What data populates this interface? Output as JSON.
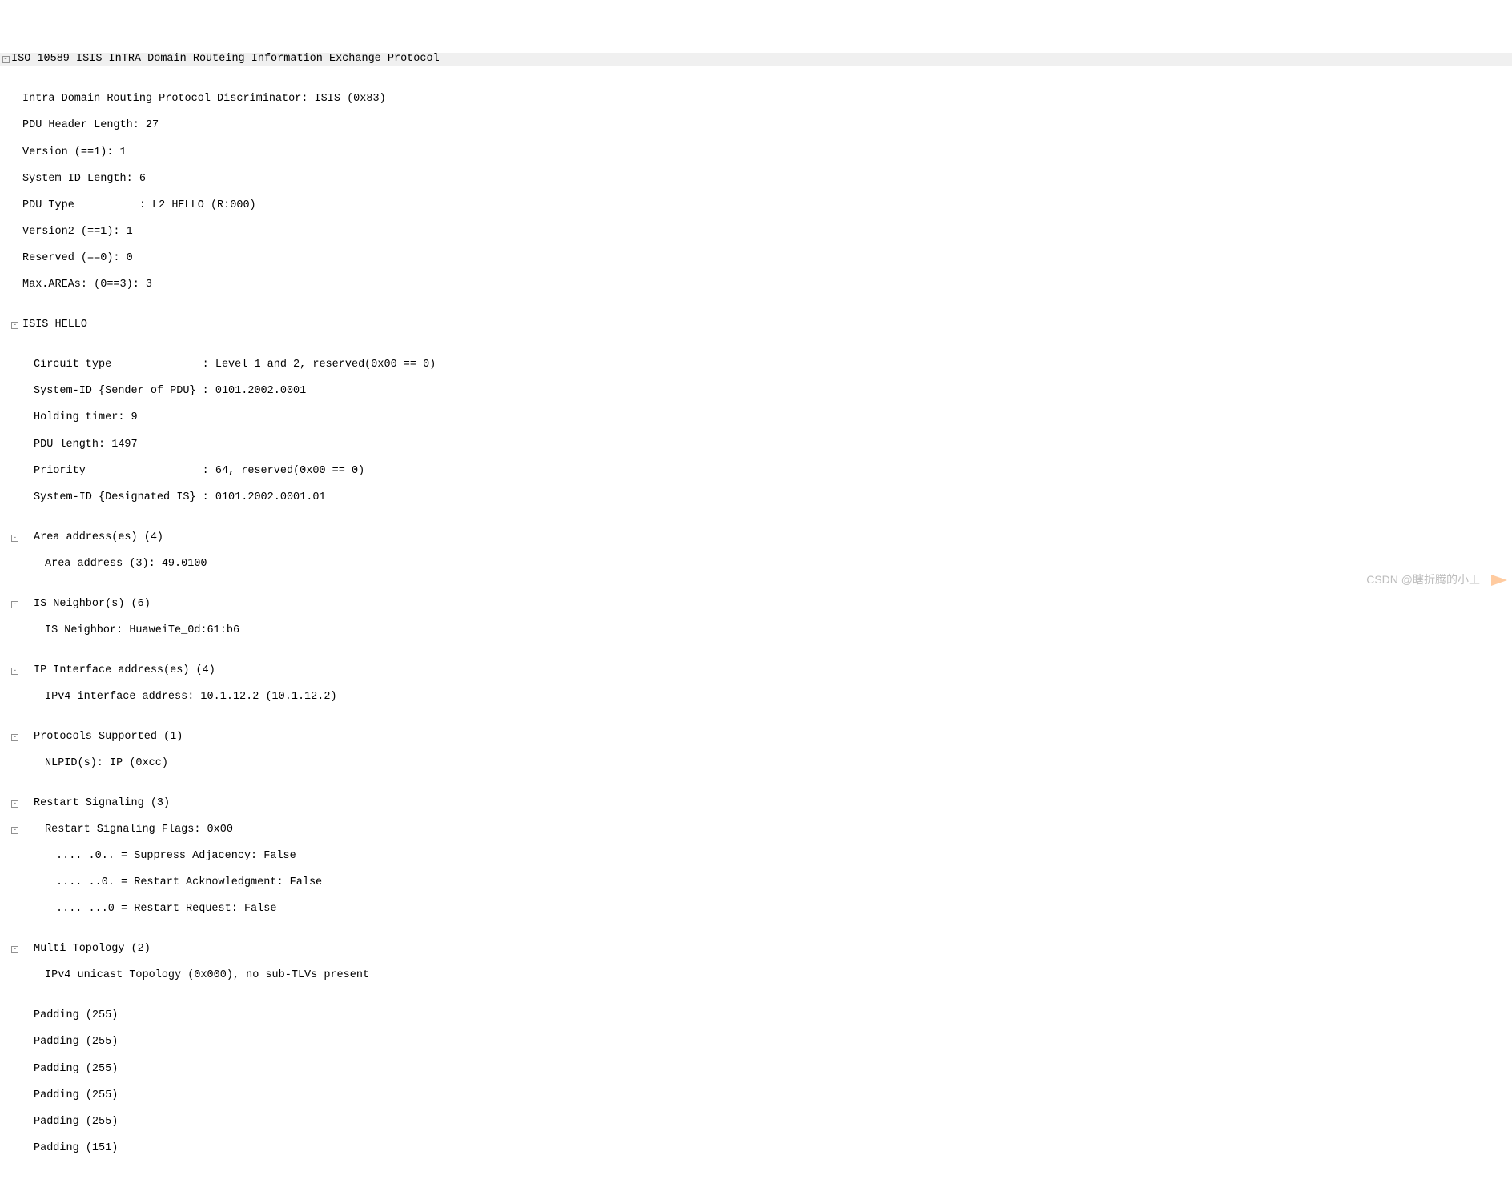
{
  "title": "ISO 10589 ISIS InTRA Domain Routeing Information Exchange Protocol",
  "fields": [
    "Intra Domain Routing Protocol Discriminator: ISIS (0x83)",
    "PDU Header Length: 27",
    "Version (==1): 1",
    "System ID Length: 6",
    "PDU Type          : L2 HELLO (R:000)",
    "Version2 (==1): 1",
    "Reserved (==0): 0",
    "Max.AREAs: (0==3): 3"
  ],
  "hello": {
    "label": "ISIS HELLO",
    "fields": [
      "Circuit type              : Level 1 and 2, reserved(0x00 == 0)",
      "System-ID {Sender of PDU} : 0101.2002.0001",
      "Holding timer: 9",
      "PDU length: 1497",
      "Priority                  : 64, reserved(0x00 == 0)",
      "System-ID {Designated IS} : 0101.2002.0001.01"
    ],
    "area": {
      "label": "Area address(es) (4)",
      "item": "Area address (3): 49.0100"
    },
    "isn": {
      "label": "IS Neighbor(s) (6)",
      "item": "IS Neighbor: HuaweiTe_0d:61:b6"
    },
    "ipif": {
      "label": "IP Interface address(es) (4)",
      "item": "IPv4 interface address: 10.1.12.2 (10.1.12.2)"
    },
    "proto": {
      "label": "Protocols Supported (1)",
      "item": "NLPID(s): IP (0xcc)"
    },
    "restart": {
      "label": "Restart Signaling (3)",
      "flags_label": "Restart Signaling Flags: 0x00",
      "flags": [
        ".... .0.. = Suppress Adjacency: False",
        ".... ..0. = Restart Acknowledgment: False",
        ".... ...0 = Restart Request: False"
      ]
    },
    "mt": {
      "label": "Multi Topology (2)",
      "item": "IPv4 unicast Topology (0x000), no sub-TLVs present"
    },
    "padding": [
      "Padding (255)",
      "Padding (255)",
      "Padding (255)",
      "Padding (255)",
      "Padding (255)",
      "Padding (151)"
    ]
  },
  "watermark": "CSDN @瞎折腾的小王",
  "glyph_minus": "-"
}
